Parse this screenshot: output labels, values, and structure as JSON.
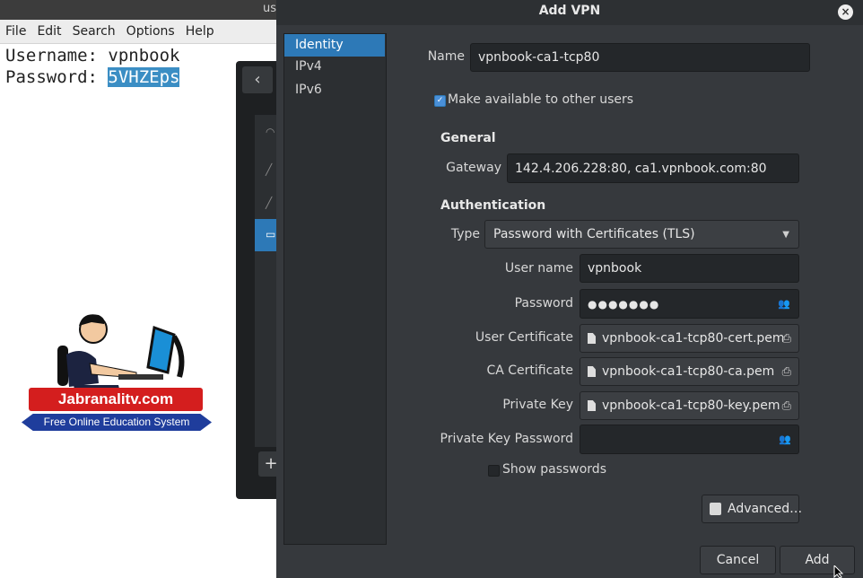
{
  "editor": {
    "title_fragment": "us",
    "menu": [
      "File",
      "Edit",
      "Search",
      "Options",
      "Help"
    ],
    "line1_label": "Username: ",
    "line1_value": "vpnbook",
    "line2_label": "Password: ",
    "line2_value": "5VHZEps"
  },
  "watermark": {
    "brand": "Jabranalitv.com",
    "tagline": "Free Online Education System"
  },
  "background_window": {
    "back_glyph": "‹",
    "add_glyph": "+"
  },
  "dialog": {
    "title": "Add VPN",
    "close_glyph": "×",
    "tabs": [
      "Identity",
      "IPv4",
      "IPv6"
    ],
    "active_tab": "Identity",
    "name_label": "Name",
    "name_value": "vpnbook-ca1-tcp80",
    "share_label": "Make available to other users",
    "share_checked": true,
    "general_heading": "General",
    "gateway_label": "Gateway",
    "gateway_value": "142.4.206.228:80, ca1.vpnbook.com:80",
    "auth_heading": "Authentication",
    "type_label": "Type",
    "type_value": "Password with Certificates (TLS)",
    "username_label": "User name",
    "username_value": "vpnbook",
    "password_label": "Password",
    "password_value": "●●●●●●●",
    "user_cert_label": "User Certificate",
    "user_cert_value": "vpnbook-ca1-tcp80-cert.pem",
    "ca_cert_label": "CA Certificate",
    "ca_cert_value": "vpnbook-ca1-tcp80-ca.pem",
    "private_key_label": "Private Key",
    "private_key_value": "vpnbook-ca1-tcp80-key.pem",
    "private_key_password_label": "Private Key Password",
    "private_key_password_value": "",
    "show_passwords_label": "Show passwords",
    "show_passwords_checked": false,
    "advanced_label": "Advanced…",
    "cancel_label": "Cancel",
    "add_label": "Add"
  },
  "colors": {
    "accent": "#2d79b7",
    "dialog_bg": "#36393d",
    "field_bg": "#24272a",
    "logo_red": "#d41e1e",
    "logo_blue": "#1f3d9c"
  }
}
